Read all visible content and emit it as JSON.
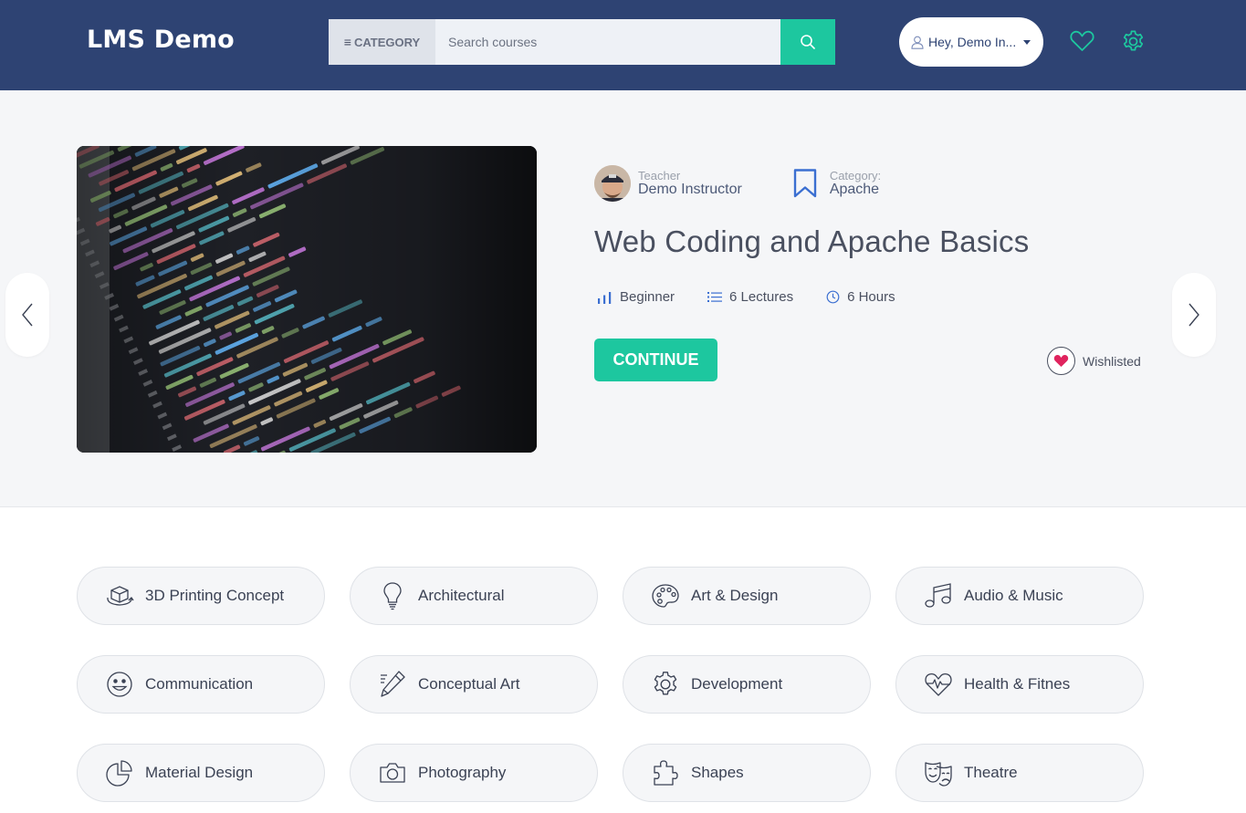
{
  "header": {
    "brand": "LMS Demo",
    "category_label": "CATEGORY",
    "search_placeholder": "Search courses",
    "user_label": "Hey, Demo In...",
    "accent_color": "#1dc79f",
    "background_color": "#2e4373"
  },
  "hero": {
    "teacher_label": "Teacher",
    "teacher_name": "Demo Instructor",
    "category_label": "Category:",
    "category_value": "Apache",
    "title": "Web Coding and Apache Basics",
    "level": "Beginner",
    "lectures": "6 Lectures",
    "duration": "6 Hours",
    "continue_label": "CONTINUE",
    "wishlist_label": "Wishlisted"
  },
  "categories": [
    {
      "label": "3D Printing Concept",
      "icon": "3d-box-icon"
    },
    {
      "label": "Architectural",
      "icon": "lightbulb-icon"
    },
    {
      "label": "Art & Design",
      "icon": "palette-icon"
    },
    {
      "label": "Audio & Music",
      "icon": "music-note-icon"
    },
    {
      "label": "Communication",
      "icon": "smiley-icon"
    },
    {
      "label": "Conceptual Art",
      "icon": "pencil-icon"
    },
    {
      "label": "Development",
      "icon": "gear-icon"
    },
    {
      "label": "Health & Fitnes",
      "icon": "heart-pulse-icon"
    },
    {
      "label": "Material Design",
      "icon": "pie-chart-icon"
    },
    {
      "label": "Photography",
      "icon": "camera-icon"
    },
    {
      "label": "Shapes",
      "icon": "puzzle-icon"
    },
    {
      "label": "Theatre",
      "icon": "theatre-mask-icon"
    }
  ]
}
